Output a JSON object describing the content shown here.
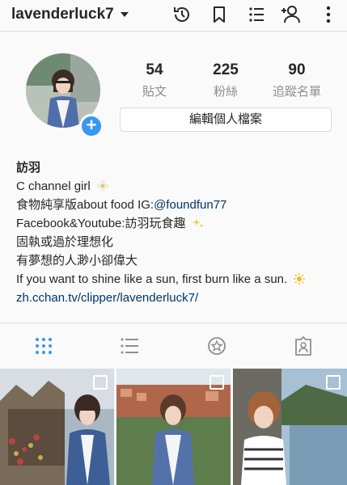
{
  "header": {
    "username": "lavenderluck7"
  },
  "profile": {
    "stats": [
      {
        "value": "54",
        "label": "貼文"
      },
      {
        "value": "225",
        "label": "粉絲"
      },
      {
        "value": "90",
        "label": "追蹤名單"
      }
    ],
    "edit_button": "編輯個人檔案"
  },
  "bio": {
    "name": "訪羽",
    "line1": "C channel girl",
    "line2_text": "食物純享版about food IG:",
    "line2_link": "@foundfun77",
    "line3": "Facebook&Youtube:訪羽玩食趣",
    "line4": "固執或過於理想化",
    "line5": "有夢想的人渺小卻偉大",
    "line6": "If you want to shine like a sun, first burn like a sun.",
    "website": "zh.cchan.tv/clipper/lavenderluck7/"
  },
  "icons": {
    "history": "history-icon",
    "bookmark": "bookmark-icon",
    "list": "list-icon",
    "add_person": "add-person-icon",
    "more": "more-vertical-icon",
    "grid_tab": "grid-icon",
    "list_tab": "list-view-icon",
    "igtv_tab": "star-badge-icon",
    "tagged_tab": "tagged-icon"
  },
  "colors": {
    "accent": "#3897f0",
    "link": "#003569",
    "active_tab": "#3897f0"
  }
}
